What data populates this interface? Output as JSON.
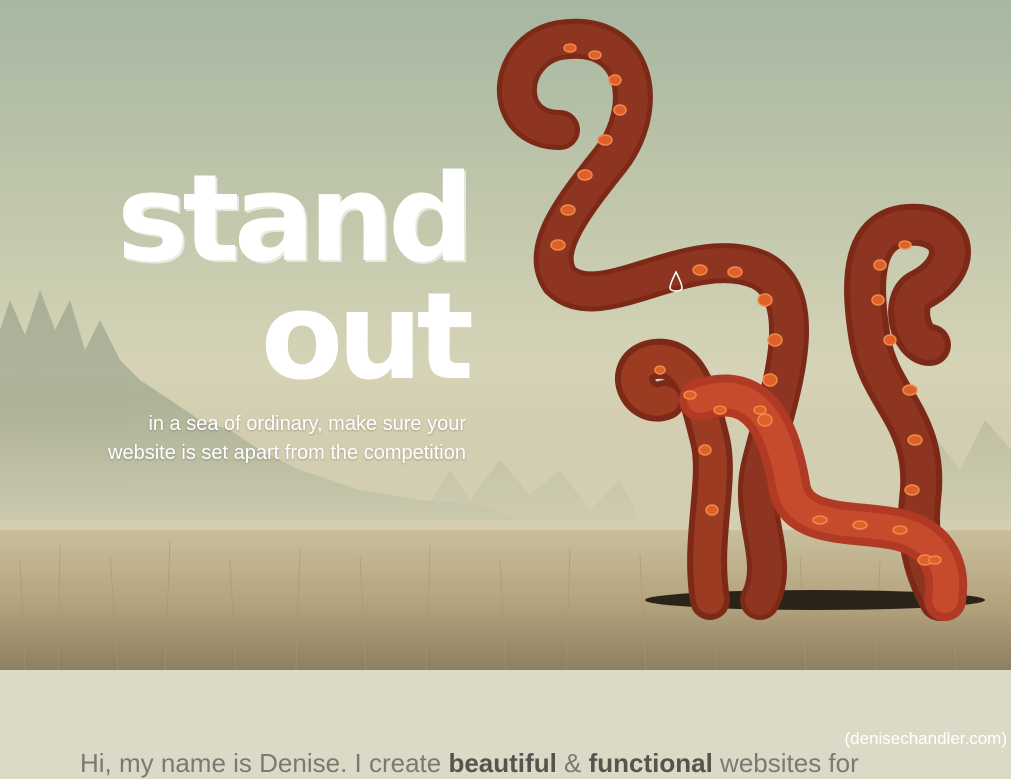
{
  "hero": {
    "headline_line1": "stand",
    "headline_line2": "out",
    "tagline_line1": "in a sea of ordinary, make sure your",
    "tagline_line2": "website is set apart from the competition"
  },
  "footer": {
    "domain_label": "(denisechandler.com)"
  },
  "intro": {
    "text_start": "Hi, my name is Denise. I create ",
    "bold_1": "beautiful",
    "amp": " & ",
    "bold_2": "functional",
    "text_end": " websites for"
  },
  "colors": {
    "page_bg": "#dcdac6",
    "tentacle": "#8a2e1a",
    "sucker": "#e0602a",
    "headline": "#ffffff"
  }
}
